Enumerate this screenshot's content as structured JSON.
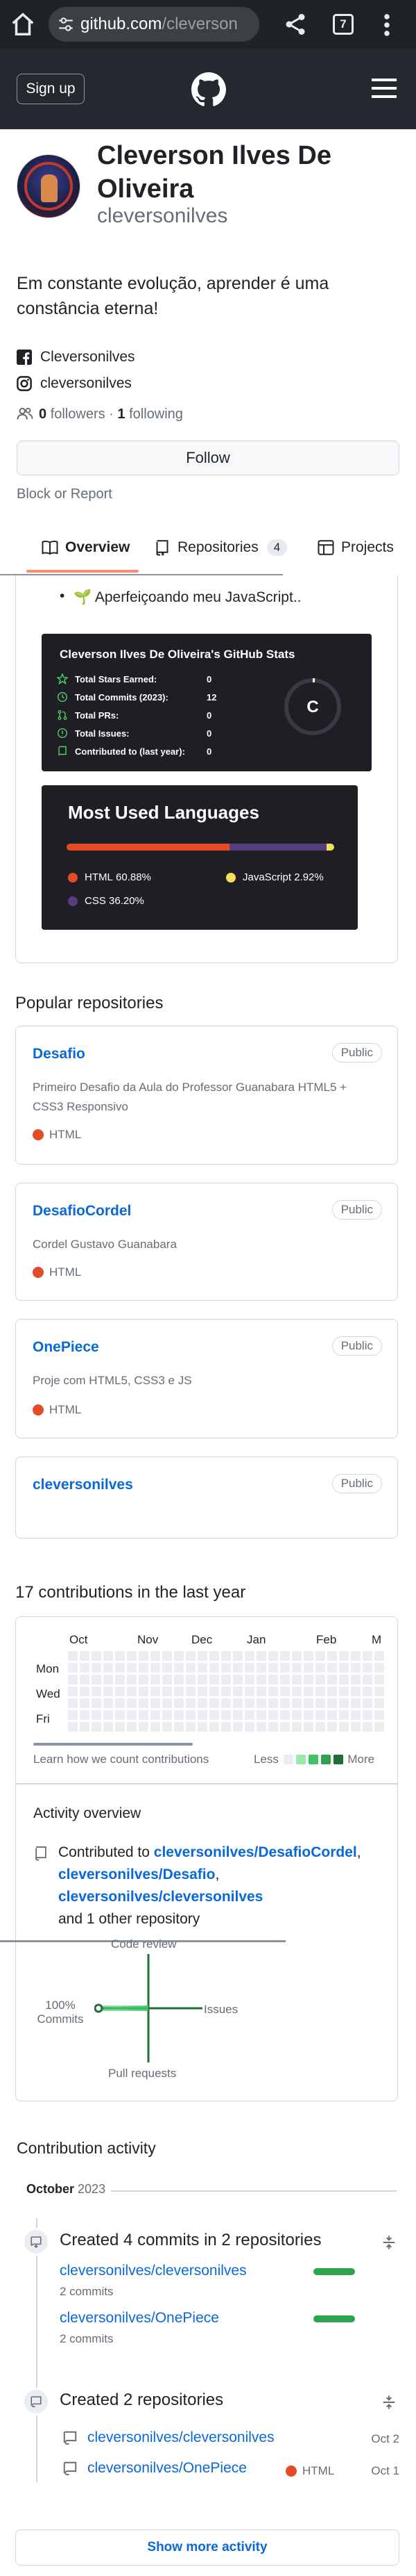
{
  "browser": {
    "url_host": "github.com",
    "url_path": "/cleverson",
    "tab_count": "7"
  },
  "header": {
    "signup_label": "Sign up"
  },
  "profile": {
    "full_name": "Cleverson Ilves De Oliveira",
    "username": "cleversonilves",
    "bio": "Em constante evolução, aprender é uma constância eterna!",
    "facebook": "Cleversonilves",
    "instagram": "cleversonilves",
    "followers_count": "0",
    "followers_label": "followers",
    "separator": "·",
    "following_count": "1",
    "following_label": "following",
    "follow_label": "Follow",
    "block_report_label": "Block or Report"
  },
  "tabs": [
    {
      "label": "Overview",
      "icon": "book-icon"
    },
    {
      "label": "Repositories",
      "count": "4",
      "icon": "repo-icon"
    },
    {
      "label": "Projects",
      "icon": "table-icon"
    }
  ],
  "readme": {
    "bullet": "🌱 Aperfeiçoando meu JavaScript.."
  },
  "stats_card": {
    "title": "Cleverson Ilves De Oliveira's GitHub Stats",
    "rows": [
      {
        "label": "Total Stars Earned:",
        "value": "0",
        "icon": "star-icon"
      },
      {
        "label": "Total Commits (2023):",
        "value": "12",
        "icon": "history-icon"
      },
      {
        "label": "Total PRs:",
        "value": "0",
        "icon": "pr-icon"
      },
      {
        "label": "Total Issues:",
        "value": "0",
        "icon": "issue-icon"
      },
      {
        "label": "Contributed to (last year):",
        "value": "0",
        "icon": "repo-icon"
      }
    ],
    "rank": "C",
    "accent": "#4fd36a"
  },
  "languages_card": {
    "title": "Most Used Languages",
    "items": [
      {
        "name": "HTML",
        "percent": "60.88%",
        "value": 60.88,
        "color": "#e34c26"
      },
      {
        "name": "JavaScript",
        "percent": "2.92%",
        "value": 2.92,
        "color": "#f1e05a"
      },
      {
        "name": "CSS",
        "percent": "36.20%",
        "value": 36.2,
        "color": "#563d7c"
      }
    ]
  },
  "popular": {
    "title": "Popular repositories",
    "repos": [
      {
        "name": "Desafio",
        "visibility": "Public",
        "description": "Primeiro Desafio da Aula do Professor Guanabara HTML5 + CSS3 Responsivo",
        "language": "HTML"
      },
      {
        "name": "DesafioCordel",
        "visibility": "Public",
        "description": "Cordel Gustavo Guanabara",
        "language": "HTML"
      },
      {
        "name": "OnePiece",
        "visibility": "Public",
        "description": "Proje com HTML5, CSS3 e JS",
        "language": "HTML"
      },
      {
        "name": "cleversonilves",
        "visibility": "Public",
        "description": "",
        "language": ""
      }
    ]
  },
  "contributions": {
    "title": "17 contributions in the last year",
    "months": [
      "Oct",
      "Nov",
      "Dec",
      "Jan",
      "Feb",
      "M"
    ],
    "weekdays": [
      "Mon",
      "Wed",
      "Fri"
    ],
    "learn_label": "Learn how we count contributions",
    "less_label": "Less",
    "more_label": "More",
    "legend_colors": [
      "#ebedf0",
      "#9be9a8",
      "#40c463",
      "#30a14e",
      "#216e39"
    ]
  },
  "activity_overview": {
    "title": "Activity overview",
    "prefix": "Contributed to",
    "repo1": "cleversonilves/DesafioCordel",
    "repo2": "cleversonilves/Desafio",
    "repo3": "cleversonilves/cleversonilves",
    "suffix": "and 1 other repository",
    "radar_top": "Code review",
    "radar_left_value": "100%",
    "radar_left": "Commits",
    "radar_right": "Issues",
    "radar_bottom": "Pull requests"
  },
  "contribution_activity": {
    "title": "Contribution activity",
    "month": "October",
    "year": "2023",
    "commits_title": "Created 4 commits in 2 repositories",
    "commit_repos": [
      {
        "name": "cleversonilves/cleversonilves",
        "count": "2 commits"
      },
      {
        "name": "cleversonilves/OnePiece",
        "count": "2 commits"
      }
    ],
    "created_title": "Created 2 repositories",
    "created_repos": [
      {
        "name": "cleversonilves/cleversonilves",
        "language": "",
        "date": "Oct 2"
      },
      {
        "name": "cleversonilves/OnePiece",
        "language": "HTML",
        "date": "Oct 1"
      }
    ],
    "show_more": "Show more activity"
  }
}
